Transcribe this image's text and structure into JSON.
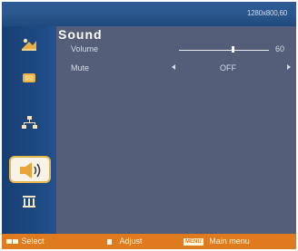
{
  "header": {
    "resolution": "1280x800,60"
  },
  "sidebar": {
    "items": [
      {
        "icon": "picture-icon"
      },
      {
        "icon": "display-icon"
      },
      {
        "icon": "network-icon"
      },
      {
        "icon": "speaker-icon",
        "selected": true
      },
      {
        "icon": "columns-icon"
      },
      {
        "icon": "language-icon"
      }
    ]
  },
  "main": {
    "title": "Sound",
    "volume": {
      "label": "Volume",
      "value": "60",
      "level": 0.6
    },
    "mute": {
      "label": "Mute",
      "value": "OFF"
    }
  },
  "footer": {
    "select_label": "Select",
    "adjust_label": "Adjust",
    "menu_key": "MENU",
    "menu_label": "Main menu"
  },
  "colors": {
    "background": "#4c5673",
    "header": "#2a568c",
    "footer": "#e07a1f",
    "selected_border": "#e5b54d"
  }
}
